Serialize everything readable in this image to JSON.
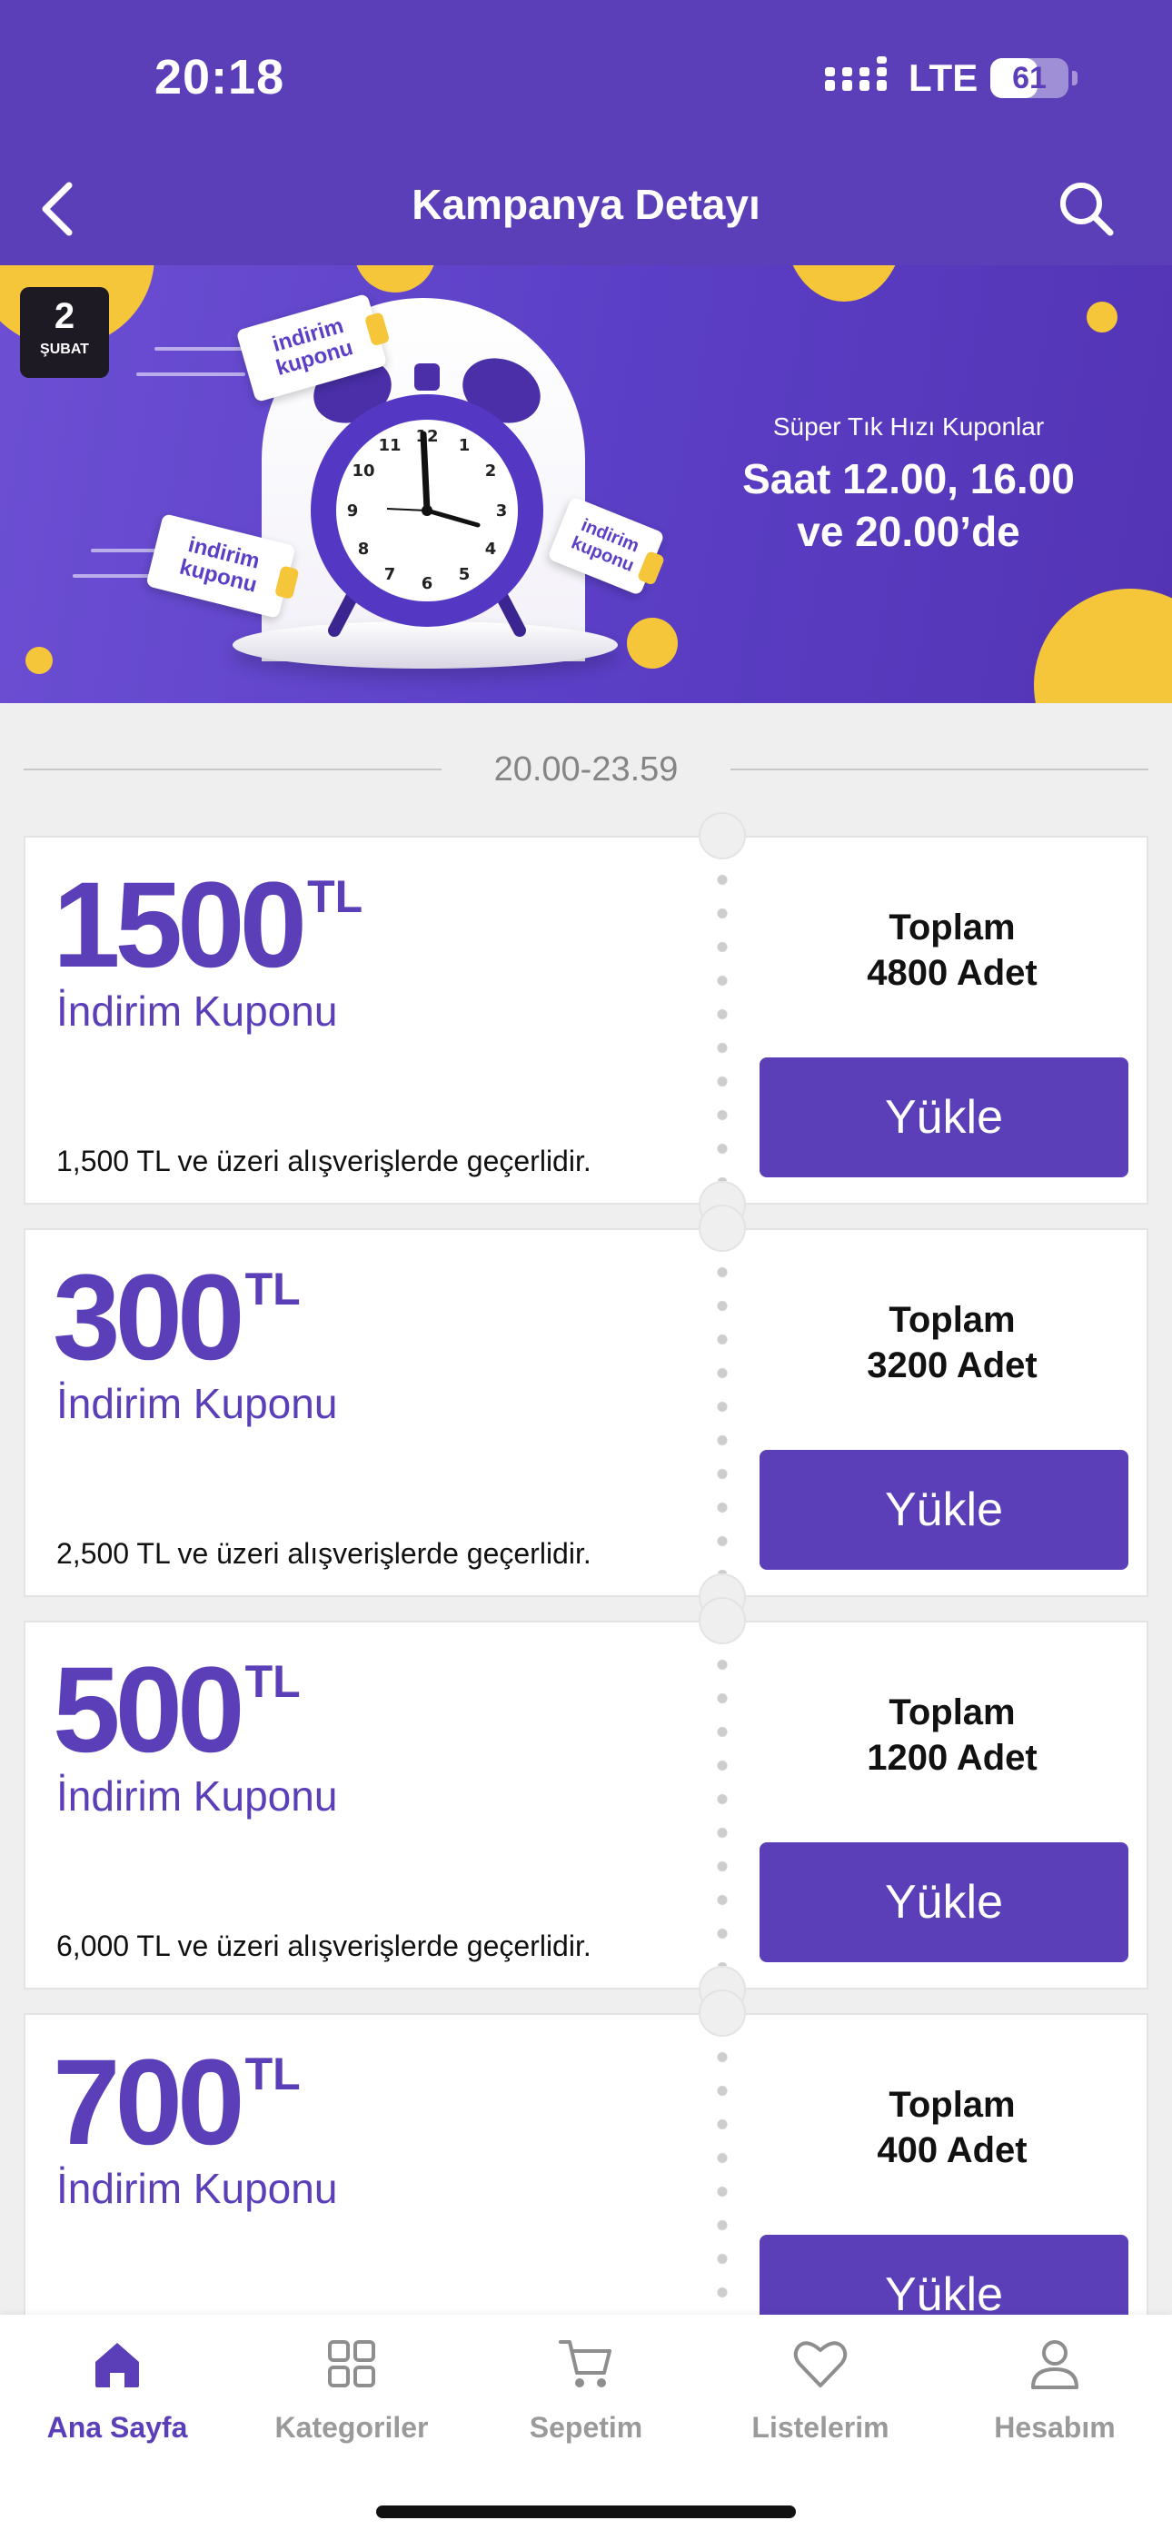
{
  "status": {
    "time": "20:18",
    "network": "LTE",
    "battery": "61",
    "battery_level": 0.61
  },
  "header": {
    "title": "Kampanya Detayı"
  },
  "banner": {
    "date_day": "2",
    "date_month": "ŞUBAT",
    "ticket_text": "indirim kuponu",
    "subtitle": "Süper Tık Hızı Kuponlar",
    "headline_line1": "Saat 12.00, 16.00",
    "headline_line2": "ve 20.00’de",
    "accent_color": "#f5c63a",
    "background_color": "#5b3fc6"
  },
  "slot": {
    "label": "20.00-23.59"
  },
  "coupons": [
    {
      "amount": "1500",
      "currency": "TL",
      "label": "İndirim Kuponu",
      "condition": "1,500 TL ve üzeri alışverişlerde geçerlidir.",
      "stock_line1": "Toplam",
      "stock_line2": "4800 Adet",
      "button": "Yükle"
    },
    {
      "amount": "300",
      "currency": "TL",
      "label": "İndirim Kuponu",
      "condition": "2,500 TL ve üzeri alışverişlerde geçerlidir.",
      "stock_line1": "Toplam",
      "stock_line2": "3200 Adet",
      "button": "Yükle"
    },
    {
      "amount": "500",
      "currency": "TL",
      "label": "İndirim Kuponu",
      "condition": "6,000 TL ve üzeri alışverişlerde geçerlidir.",
      "stock_line1": "Toplam",
      "stock_line2": "1200 Adet",
      "button": "Yükle"
    },
    {
      "amount": "700",
      "currency": "TL",
      "label": "İndirim Kuponu",
      "condition": "",
      "stock_line1": "Toplam",
      "stock_line2": "400 Adet",
      "button": "Yükle"
    }
  ],
  "tabbar": {
    "items": [
      {
        "label": "Ana Sayfa",
        "icon": "home-icon",
        "active": true
      },
      {
        "label": "Kategoriler",
        "icon": "grid-icon",
        "active": false
      },
      {
        "label": "Sepetim",
        "icon": "cart-icon",
        "active": false
      },
      {
        "label": "Listelerim",
        "icon": "heart-icon",
        "active": false
      },
      {
        "label": "Hesabım",
        "icon": "user-icon",
        "active": false
      }
    ]
  },
  "colors": {
    "brand": "#5b3fb9",
    "page_bg": "#efefef",
    "inactive_tab": "#9a9a9a"
  }
}
